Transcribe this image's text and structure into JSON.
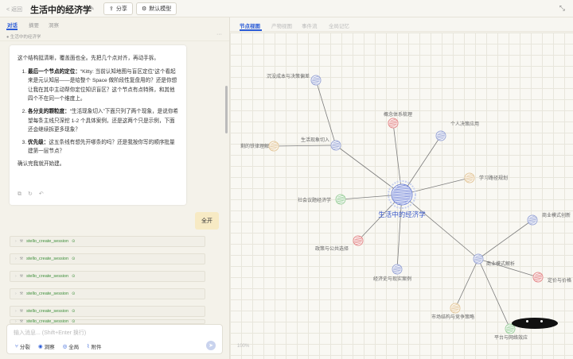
{
  "header": {
    "back_label": "< 返回",
    "title": "生活中的经济学",
    "share_label": "分享",
    "model_label": "默认模型"
  },
  "left_tabs": [
    "对话",
    "摘要",
    "洞察"
  ],
  "subbar_text": "生活中的经济学",
  "message": {
    "intro": "这个结构挺清晰，覆盖面也全。先把几个点对齐，再动手拆。",
    "items": [
      {
        "bold": "最后一个节点的定位：",
        "text": "“Kitty: 当前认知地图与盲区定位”这个看起来是元认知层——是给整个 Space 做阶段性复盘用的？还是你想让我在其中主动帮你定位知识盲区？这个节点有点特殊，和其他四个不在同一个维度上。"
      },
      {
        "bold": "各分支的颗粒度：",
        "text": "“生活现象切入”下面只列了两个现象，是说你希望每条主线只深挖 1-2 个具体案例，还是这两个只是示例，下面还会继续拆更多现象？"
      },
      {
        "bold": "优先级：",
        "text": "这五条线有想先开哪条的吗？还是我按你写的顺序批量建第一层节点？"
      }
    ],
    "confirm": "确认完我就开始建。"
  },
  "expand_label": "全开",
  "tool_calls": [
    "stello_create_session",
    "stello_create_session",
    "stello_create_session",
    "stello_create_session",
    "stello_create_session",
    "stello_create_session"
  ],
  "input": {
    "placeholder": "输入消息... (Shift+Enter 换行)",
    "tools": [
      "分裂",
      "洞察",
      "全局",
      "附件"
    ]
  },
  "right_tabs": [
    "节点视图",
    "产物视图",
    "事件流",
    "全局记忆"
  ],
  "zoom_label": "100%",
  "mindmap": {
    "center": {
      "label": "生活中的经济学",
      "color": "#6f82d6"
    },
    "nodes": [
      {
        "id": "n1",
        "label": "沉没成本与决策偏差",
        "color": "#9aa6d6"
      },
      {
        "id": "n2",
        "label": "生活现象切入",
        "color": "#9aa6d6"
      },
      {
        "id": "n3",
        "label": "剩的铁律理解",
        "color": "#e3c79a"
      },
      {
        "id": "n4",
        "label": "概念体系梳理",
        "color": "#e48a8a"
      },
      {
        "id": "n5",
        "label": "个人决策应用",
        "color": "#9aa6d6"
      },
      {
        "id": "n6",
        "label": "学习路径规划",
        "color": "#e3c79a"
      },
      {
        "id": "n7",
        "label": "社会议题经济学",
        "color": "#9ccf9c"
      },
      {
        "id": "n8",
        "label": "政策与公共选择",
        "color": "#e48a8a"
      },
      {
        "id": "n9",
        "label": "经济史与现实案例",
        "color": "#9aa6d6"
      },
      {
        "id": "n10",
        "label": "商业模式解析",
        "color": "#9aa6d6"
      },
      {
        "id": "n11",
        "label": "商业模式创新",
        "color": "#9aa6d6"
      },
      {
        "id": "n12",
        "label": "定价与价格",
        "color": "#e48a8a"
      },
      {
        "id": "n13",
        "label": "市场结构与竞争策略",
        "color": "#e3c79a"
      },
      {
        "id": "n14",
        "label": "平台与网络效应",
        "color": "#9ccf9c"
      }
    ]
  }
}
